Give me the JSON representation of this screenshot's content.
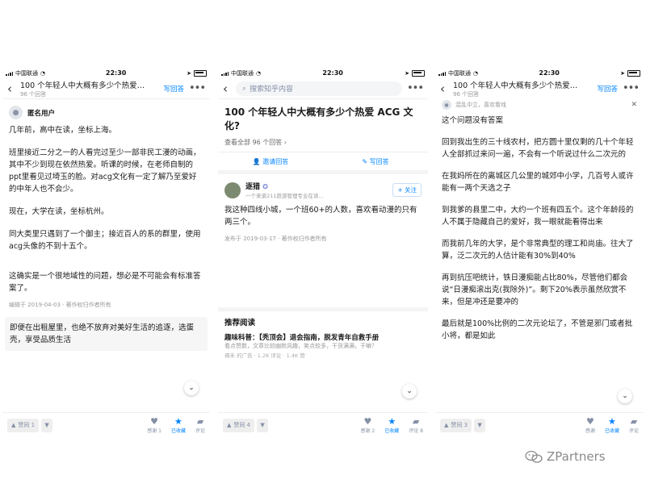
{
  "status_bar": {
    "carrier": "中国联通",
    "time": "22:30"
  },
  "left": {
    "nav_title": "100 个年轻人中大概有多少个热爱…",
    "nav_subtitle": "96 个回答",
    "write_label": "写回答",
    "author_name": "匿名用户",
    "paragraphs": [
      "几年前，高中在读，坐标上海。",
      "班里接近二分之一的人看完过至少一部非民工漫的动画，其中不少到现在依然热爱。听课的时候，在老师自制的ppt里看见过埼玉的脸。对acg文化有一定了解乃至爱好的中年人也不会少。",
      "现在，大学在读，坐标杭州。",
      "同大类里只遇到了一个御主；接近百人的系的群里，使用acg头像的不到十五个。",
      "这确实是一个很地域性的问题，想必是不可能会有标准答案了。"
    ],
    "meta": "编辑于 2019-04-03 · 著作权归作者所有",
    "ad_text": "即便在出租屋里，也绝不放弃对美好生活的追逐，选蛋壳，享受品质生活",
    "bottom": {
      "vote": "赞同 1",
      "thanks": "感谢 1",
      "collected": "已收藏",
      "comment": "评论"
    }
  },
  "middle": {
    "search_placeholder": "搜索知乎内容",
    "question_title": "100 个年轻人中大概有多少个热爱 ACG 文化?",
    "view_all": "查看全部 96 个回答 ›",
    "invite_label": "邀请回答",
    "write_label": "写回答",
    "author_name": "逐猎",
    "author_desc": "一个来滚211旅游管理专业在读...",
    "follow_label": "+ 关注",
    "answer_text": "我这种四线小城，一个班60+的人数，喜欢看动漫的只有两三个。",
    "meta": "发布于 2019-03-17 · 著作权归作者所有",
    "rec_title": "推荐阅读",
    "rec_head": "趣味科普：【秃顶会】退会指南，脱发青年自救手册",
    "rec_desc": "看点赞数，文章比较幽默风趣，笑点较多，干货满满，干嘛？",
    "rec_meta": "褐禾 的广告 · 1.2K 评论 · 1.4K 赞",
    "bottom": {
      "vote": "赞同 4",
      "thanks": "感谢 2",
      "collected": "已收藏",
      "comment": "评论 8"
    }
  },
  "right": {
    "nav_title": "100 个年轻人中大概有多少个热爱…",
    "nav_subtitle": "96 个回答",
    "write_label": "写回答",
    "author_desc": "混乱中立，喜欢看戏",
    "paragraphs": [
      "这个问题没有答案",
      "回到我出生的三十线农村，把方圆十里仅剩的几十个年轻人全部抓过来问一遍，不会有一个听说过什么二次元的",
      "在我妈所在的离城区几公里的城郊中小学，几百号人或许能有一两个天选之子",
      "到我爹的县里二中，大约一个班有四五个。这个年龄段的人不属于隐藏自己的爱好，我一眼就能看得出来",
      "而我前几年的大学，是个非常典型的理工和尚庙。往大了算，泛二次元的人估计能有30%到40%",
      "再到抗压吧统计，铁日漫痴能占比80%，尽管他们都会说“日漫痴滚出克(我除外)”。剩下20%表示虽然欣赏不来，但是冲还是要冲的",
      "最后就是100%比例的二次元论坛了，不管是邪门或者批小将，都是如此"
    ],
    "bottom": {
      "vote": "赞同 3",
      "thanks": "感谢",
      "collected": "已收藏",
      "comment": "评论"
    }
  },
  "watermark": {
    "text": "ZPartners"
  },
  "colors": {
    "accent": "#0084ff",
    "muted": "#8590a6"
  }
}
